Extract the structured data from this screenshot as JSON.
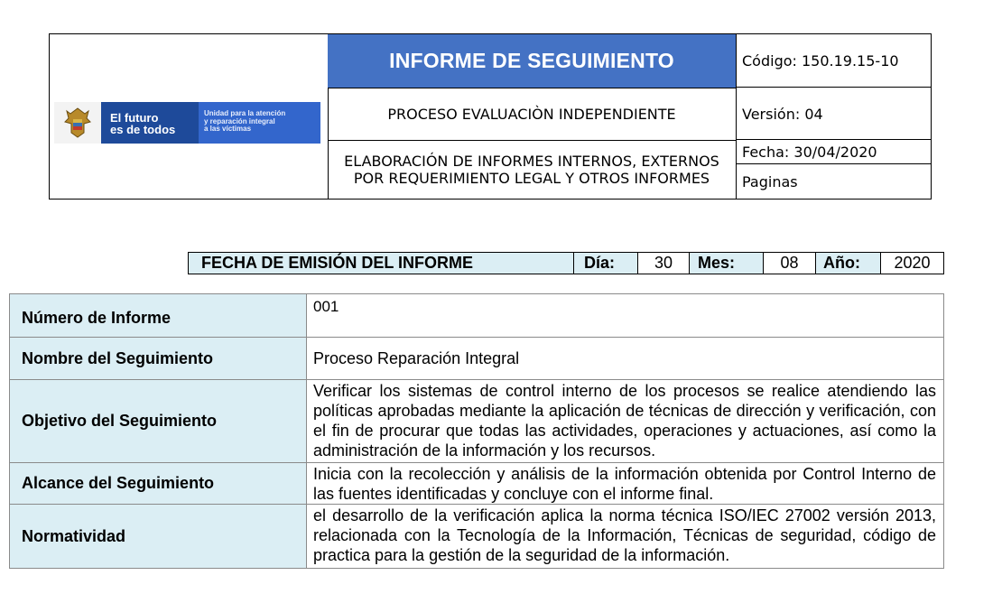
{
  "header": {
    "title": "INFORME DE SEGUIMIENTO",
    "process": "PROCESO EVALUACIÒN INDEPENDIENTE",
    "elaboration": "ELABORACIÓN DE INFORMES INTERNOS, EXTERNOS POR REQUERIMIENTO LEGAL Y OTROS INFORMES",
    "codigo": "Código: 150.19.15-10",
    "version": "Versión: 04",
    "fecha": "Fecha: 30/04/2020",
    "paginas": "Paginas",
    "logo": {
      "icon": "coat-of-arms-icon",
      "brand_line1": "El futuro",
      "brand_line2": "es de todos",
      "unit_line1": "Unidad para la atención",
      "unit_line2": "y reparación integral",
      "unit_line3": "a las víctimas"
    }
  },
  "emission": {
    "label": "FECHA DE EMISIÓN DEL INFORME",
    "dia_label": "Día:",
    "dia": "30",
    "mes_label": "Mes:",
    "mes": "08",
    "anio_label": "Año:",
    "anio": "2020"
  },
  "info": [
    {
      "label": "Número de Informe",
      "value": "001"
    },
    {
      "label": "Nombre del Seguimiento",
      "value": "Proceso Reparación Integral"
    },
    {
      "label": "Objetivo del Seguimiento",
      "value": "Verificar los sistemas de control interno de los procesos se realice atendiendo las políticas aprobadas mediante la aplicación de técnicas de dirección y verificación, con el fin de procurar que todas las actividades, operaciones y actuaciones, así como la administración de la información y los recursos."
    },
    {
      "label": "Alcance del Seguimiento",
      "value": "Inicia con la recolección y análisis de la información obtenida por Control Interno de las fuentes identificadas y concluye con el informe final."
    },
    {
      "label": "Normatividad",
      "value": "el desarrollo de la verificación aplica la norma técnica ISO/IEC 27002 versión 2013, relacionada con la Tecnología de la Información, Técnicas de seguridad, código de practica para la gestión de la seguridad de la información."
    }
  ]
}
